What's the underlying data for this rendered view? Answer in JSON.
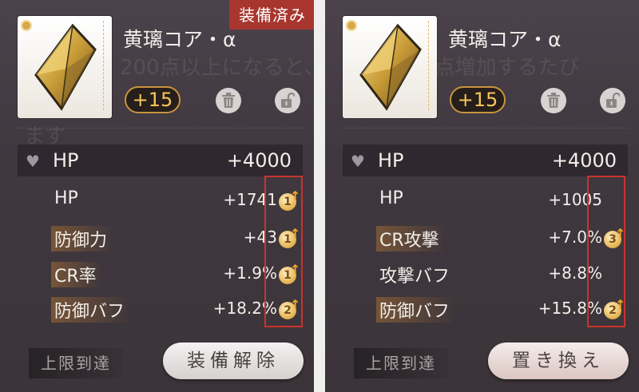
{
  "left": {
    "badge": "装備済み",
    "name": "黄璃コア・α",
    "level": "+15",
    "main_stat": {
      "label": "HP",
      "value": "+4000"
    },
    "sub_stats": [
      {
        "label": "HP",
        "value": "+1741",
        "upgrades": "1"
      },
      {
        "label": "防御力",
        "value": "+43",
        "upgrades": "1"
      },
      {
        "label": "CR率",
        "value": "+1.9%",
        "upgrades": "1"
      },
      {
        "label": "防御バフ",
        "value": "+18.2%",
        "upgrades": "2"
      }
    ],
    "max_label": "上限到達",
    "action_label": "装備解除"
  },
  "right": {
    "name": "黄璃コア・α",
    "level": "+15",
    "main_stat": {
      "label": "HP",
      "value": "+4000"
    },
    "sub_stats": [
      {
        "label": "HP",
        "value": "+1005",
        "upgrades": ""
      },
      {
        "label": "CR攻撃",
        "value": "+7.0%",
        "upgrades": "3"
      },
      {
        "label": "攻撃バフ",
        "value": "+8.8%",
        "upgrades": ""
      },
      {
        "label": "防御バフ",
        "value": "+15.8%",
        "upgrades": "2"
      }
    ],
    "max_label": "上限到達",
    "action_label": "置き換え"
  },
  "icons": {
    "trash": "trash-icon",
    "lock": "unlock-icon",
    "heart": "heart-icon",
    "upgrade": "upgrade-arrow-icon"
  },
  "colors": {
    "level_border": "#c8933f",
    "level_text": "#f6c65d",
    "highlight_box": "#c8342e",
    "equipped_badge": "#a8362f"
  }
}
